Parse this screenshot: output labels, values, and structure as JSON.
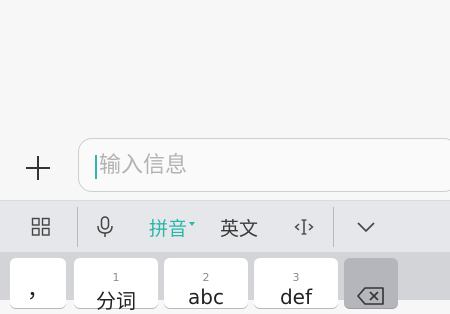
{
  "compose": {
    "placeholder": "输入信息"
  },
  "toolbar": {
    "pinyin": "拼音",
    "english": "英文"
  },
  "keys": [
    {
      "label": "，",
      "num": ""
    },
    {
      "label": "分词",
      "num": "1"
    },
    {
      "label": "abc",
      "num": "2"
    },
    {
      "label": "def",
      "num": "3"
    }
  ],
  "icons": {
    "plus": "plus-icon",
    "grid": "grid-icon",
    "mic": "microphone-icon",
    "cursor": "cursor-move-icon",
    "collapse": "chevron-down-icon",
    "backspace": "backspace-icon"
  },
  "colors": {
    "accent": "#2ab7a9",
    "caret": "#36b5b0"
  }
}
